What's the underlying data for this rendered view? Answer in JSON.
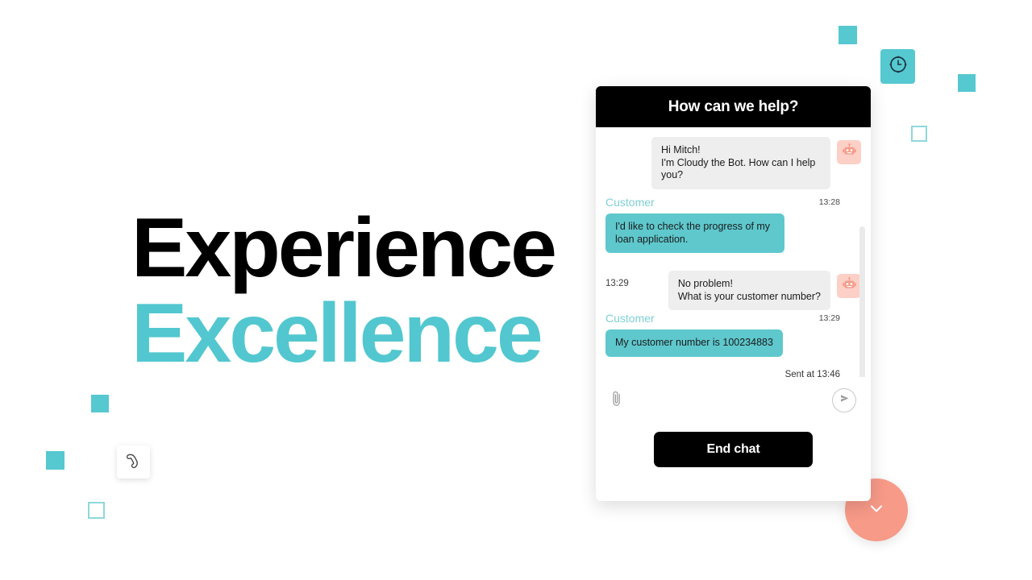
{
  "hero": {
    "line1": "Experience",
    "line2": "Excellence",
    "line1_color": "#000000",
    "line2_color": "#52c7cf"
  },
  "decorations": {
    "accent_teal": "#56c8d0",
    "outline_teal": "#8ed8dc",
    "coral": "#f79a88",
    "clock_tile_icon": "clock-icon",
    "phone_card_icon": "phone-icon",
    "fab_icon": "chevron-down-icon"
  },
  "chat": {
    "header_title": "How can we help?",
    "header_bg": "#000000",
    "bot_bubble_bg": "#eeeeee",
    "user_bubble_bg": "#5ec8cd",
    "avatar_bg": "#fcd0c6",
    "avatar_icon": "robot-icon",
    "customer_label": "Customer",
    "messages": [
      {
        "sender": "bot",
        "text": "Hi Mitch!\nI'm Cloudy the Bot. How can I help you?",
        "time": "13:28"
      },
      {
        "sender": "user",
        "text": "I'd like to check the progress of my loan application.",
        "time": "13:29"
      },
      {
        "sender": "bot",
        "text": "No problem!\nWhat is your customer number?",
        "time": "13:29"
      },
      {
        "sender": "user",
        "text": "My customer number is 100234883",
        "time": "13:46"
      }
    ],
    "msg1_text": "Hi Mitch!",
    "msg1_text2": "I'm Cloudy the Bot. How can I help you?",
    "msg1_time": "13:28",
    "msg2_text": "I'd like to check the progress of my loan application.",
    "msg2_time": "13:29",
    "msg3_text": "No problem!",
    "msg3_text2": "What is your customer number?",
    "msg3_time": "13:29",
    "msg4_text": "My customer number is 100234883",
    "sent_status": "Sent at 13:46",
    "composer": {
      "attach_icon": "paperclip-icon",
      "send_icon": "send-icon",
      "input_placeholder": ""
    },
    "end_chat_label": "End chat"
  }
}
